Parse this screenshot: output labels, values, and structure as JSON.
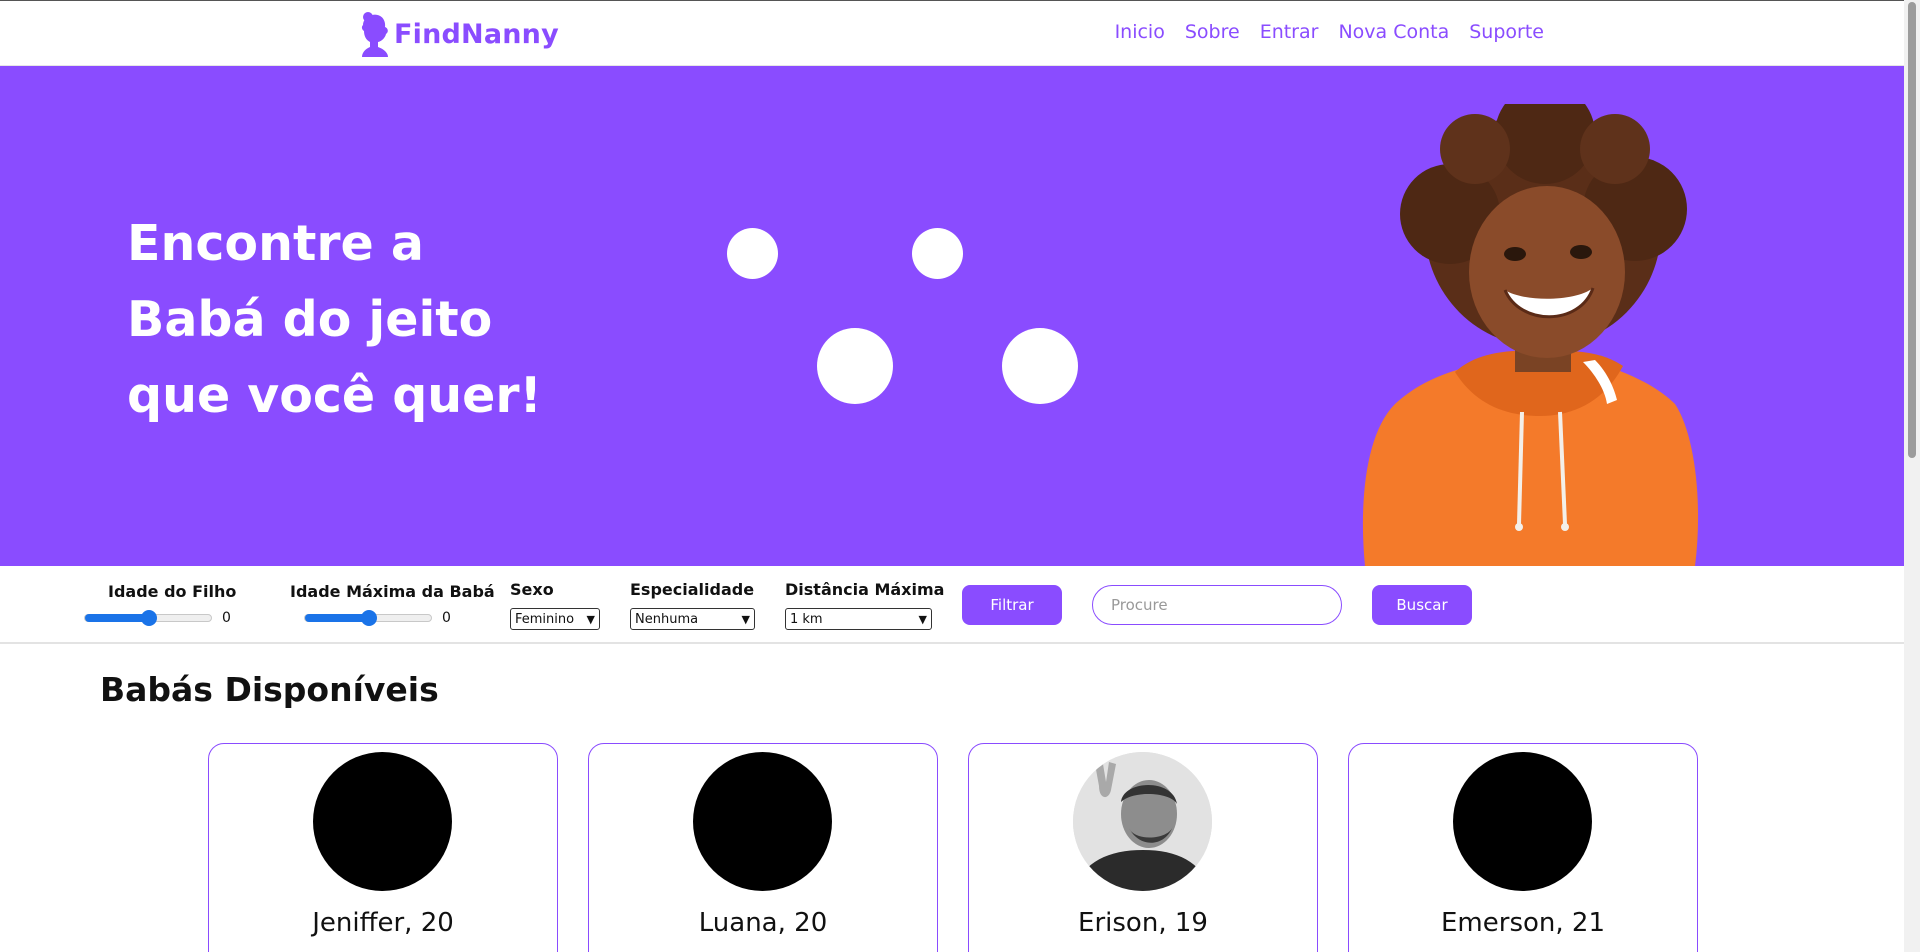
{
  "brand": {
    "name": "FindNanny",
    "color": "#8a4cff"
  },
  "nav": {
    "items": [
      "Inicio",
      "Sobre",
      "Entrar",
      "Nova Conta",
      "Suporte"
    ]
  },
  "hero": {
    "title_lines": [
      "Encontre a",
      "Babá do jeito",
      "que você quer!"
    ]
  },
  "filters": {
    "child_age_label": "Idade do Filho",
    "child_age_value": "0",
    "child_age_level": 0.5,
    "nanny_age_label": "Idade Máxima da Babá",
    "nanny_age_value": "0",
    "nanny_age_level": 0.5,
    "sex_label": "Sexo",
    "sex_value": "Feminino",
    "specialty_label": "Especialidade",
    "specialty_value": "Nenhuma",
    "distance_label": "Distância Máxima",
    "distance_value": "1 km",
    "filter_button": "Filtrar",
    "search_placeholder": "Procure",
    "search_button": "Buscar"
  },
  "list": {
    "title": "Babás Disponíveis",
    "cards": [
      {
        "name": "Jeniffer, 20",
        "photo": "none"
      },
      {
        "name": "Luana, 20",
        "photo": "none"
      },
      {
        "name": "Erison, 19",
        "photo": "person-photo"
      },
      {
        "name": "Emerson, 21",
        "photo": "none"
      }
    ]
  },
  "colors": {
    "accent": "#8a4cff",
    "slider": "#1a73e8",
    "hoodie": "#f47a2a"
  }
}
